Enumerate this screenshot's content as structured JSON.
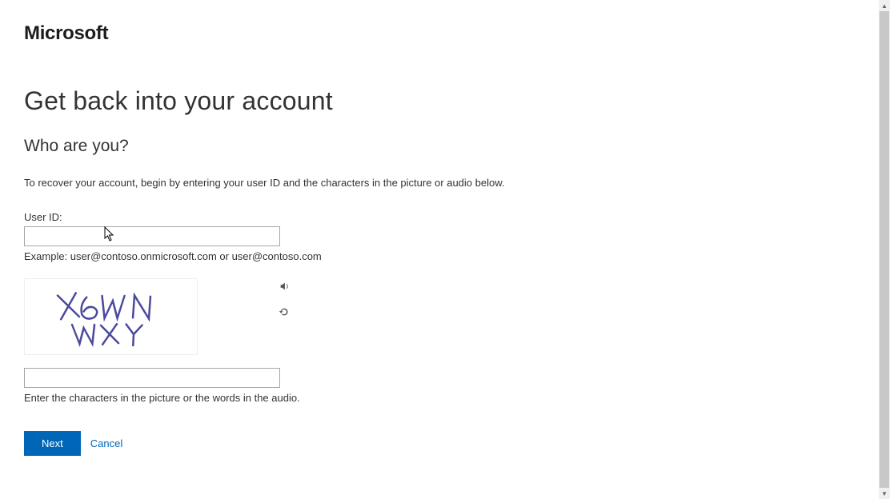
{
  "brand": "Microsoft",
  "pageTitle": "Get back into your account",
  "subtitle": "Who are you?",
  "instructions": "To recover your account, begin by entering your user ID and the characters in the picture or audio below.",
  "userId": {
    "label": "User ID:",
    "value": "",
    "hint": "Example: user@contoso.onmicrosoft.com or user@contoso.com"
  },
  "captcha": {
    "displayText": "X6WN WXY",
    "value": "",
    "hint": "Enter the characters in the picture or the words in the audio.",
    "audioIcon": "speaker-icon",
    "refreshIcon": "refresh-icon"
  },
  "actions": {
    "next": "Next",
    "cancel": "Cancel"
  },
  "colors": {
    "primary": "#0067b8",
    "text": "#333333"
  }
}
